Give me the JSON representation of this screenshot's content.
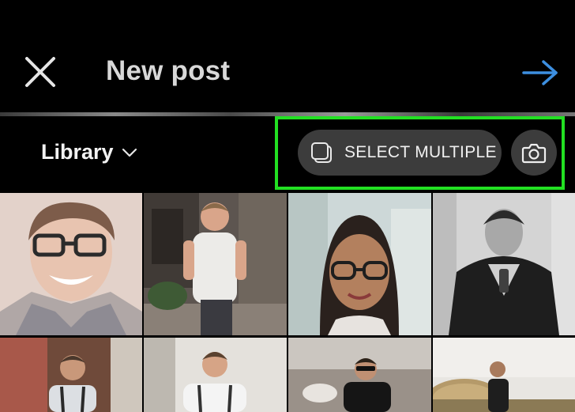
{
  "header": {
    "title": "New post",
    "close_icon": "close-icon",
    "next_icon": "arrow-right-icon",
    "accent_color": "#3d8fe0"
  },
  "toolbar": {
    "library_label": "Library",
    "select_multiple_label": "SELECT MULTIPLE",
    "highlight_color": "#22e022"
  },
  "gallery": {
    "photos": [
      "photo-smiling-man-glasses",
      "photo-man-white-tshirt",
      "photo-woman-glasses",
      "photo-man-leather-jacket",
      "photo-man-suspenders-1",
      "photo-man-suspenders-2",
      "photo-man-sunglasses",
      "photo-man-hay-field"
    ]
  }
}
